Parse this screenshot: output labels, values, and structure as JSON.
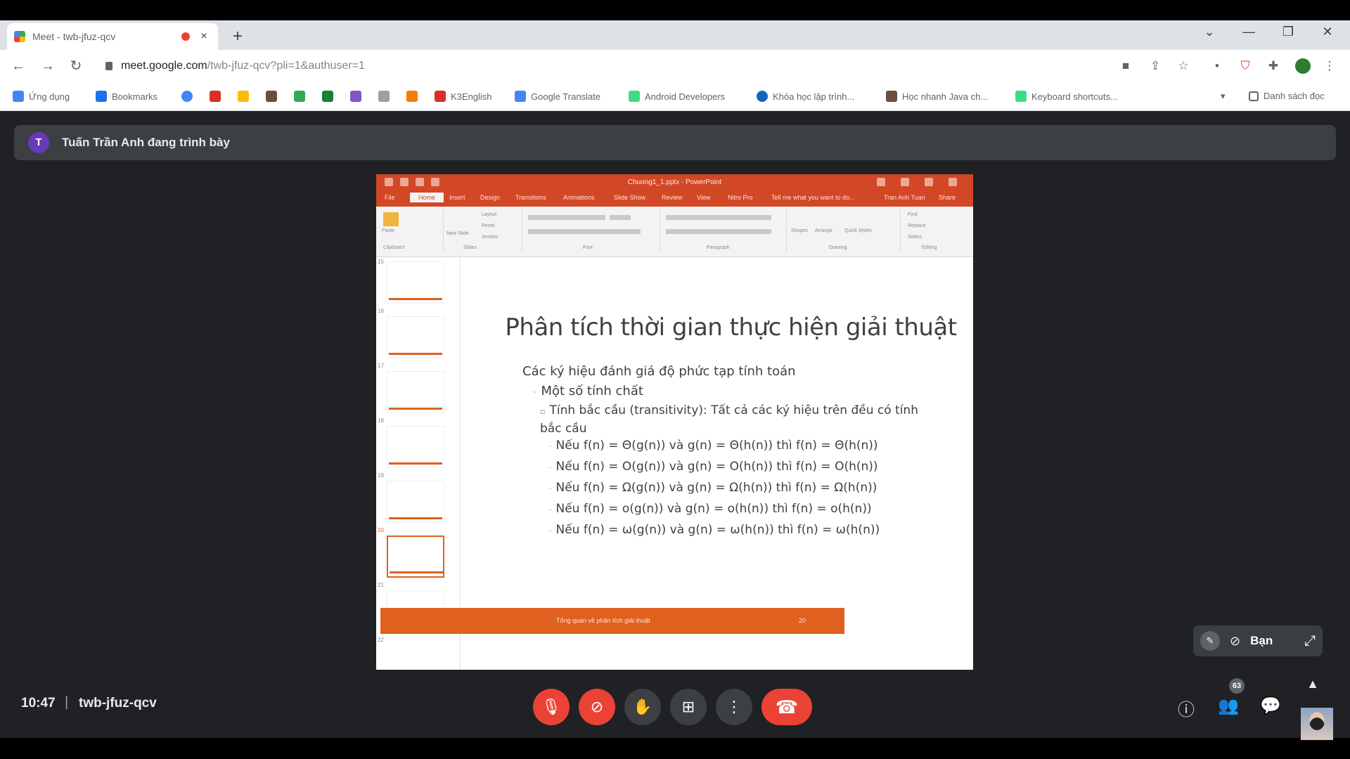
{
  "browser": {
    "tab_title": "Meet - twb-jfuz-qcv",
    "new_tab": "+",
    "close_tab": "×",
    "url_main": "meet.google.com",
    "url_rest": "/twb-jfuz-qcv?pli=1&authuser=1",
    "bookmarks": [
      {
        "label": "Ứng dụng",
        "color": "#4285f4"
      },
      {
        "label": "Bookmarks",
        "color": "#1a73e8"
      },
      {
        "label": "K3English",
        "color": "#d93025"
      },
      {
        "label": "Google Translate",
        "color": "#4285f4"
      },
      {
        "label": "Android Developers",
        "color": "#3ddc84"
      },
      {
        "label": "Khóa học lập trình...",
        "color": "#1565c0"
      },
      {
        "label": "Học nhanh Java ch...",
        "color": "#6d4c41"
      },
      {
        "label": "Keyboard shortcuts...",
        "color": "#3ddc84"
      },
      {
        "label": "Danh sách đọc",
        "color": "#5f6368"
      }
    ]
  },
  "meet": {
    "presenter_initial": "T",
    "presenter_text": "Tuấn Trần Anh đang trình bày",
    "time": "10:47",
    "separator": "|",
    "meeting_code": "twb-jfuz-qcv",
    "self_label": "Bạn",
    "participants_count": "63",
    "colors": {
      "background": "#202124",
      "danger": "#ea4335",
      "panel": "#3c4043"
    }
  },
  "powerpoint": {
    "window_title": "Chuong1_1.pptx - PowerPoint",
    "tabs": [
      "File",
      "Home",
      "Insert",
      "Design",
      "Transitions",
      "Animations",
      "Slide Show",
      "Review",
      "View",
      "Nitro Pro",
      "Tell me what you want to do...",
      "Tran Anh Tuan",
      "Share"
    ],
    "ribbon_groups": [
      "Clipboard",
      "Slides",
      "Font",
      "Paragraph",
      "Drawing",
      "Editing"
    ],
    "ribbon_items": [
      "Paste",
      "New Slide",
      "Layout",
      "Reset",
      "Section",
      "Shapes",
      "Arrange",
      "Quick Styles",
      "Find",
      "Replace",
      "Select"
    ],
    "thumb_numbers": [
      "15",
      "16",
      "17",
      "18",
      "19",
      "20",
      "21",
      "22"
    ],
    "accent": "#e0601f"
  },
  "slide": {
    "title": "Phân tích thời gian thực hiện giải thuật",
    "l1": "Các ký hiệu đánh giá độ phức tạp tính toán",
    "l2": "Một số tính chất",
    "l3": "Tính bắc cầu (transitivity): Tất cả các ký hiệu trên đều có tính bắc cầu",
    "rules": [
      "Nếu f(n) = Θ(g(n)) và g(n) = Θ(h(n)) thì f(n) = Θ(h(n))",
      "Nếu f(n) = O(g(n)) và g(n) = O(h(n)) thì f(n) = O(h(n))",
      "Nếu f(n) = Ω(g(n)) và g(n) = Ω(h(n)) thì f(n) = Ω(h(n))",
      "Nếu f(n) = o(g(n)) và g(n) = o(h(n)) thì f(n) = o(h(n))",
      "Nếu f(n) = ω(g(n)) và g(n) = ω(h(n)) thì f(n) = ω(h(n))"
    ],
    "footer_text": "Tổng quan về phân tích giải thuật",
    "page_number": "20"
  }
}
